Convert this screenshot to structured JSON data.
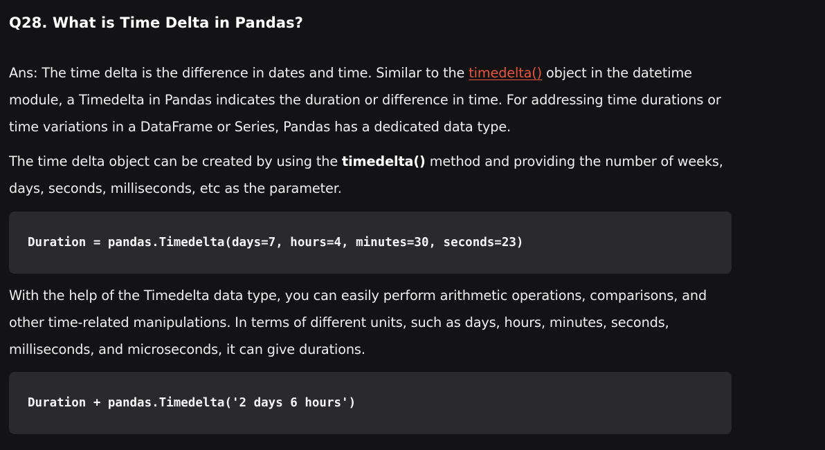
{
  "question": {
    "title": "Q28. What is Time Delta in Pandas?"
  },
  "answer": {
    "p1_before_link": "Ans: The time delta is the difference in dates and time. Similar to the ",
    "p1_link": "timedelta()",
    "p1_after_link": " object in the datetime module, a Timedelta in Pandas indicates the duration or difference in time. For addressing time durations or time variations in a DataFrame or Series, Pandas has a dedicated data type.",
    "p2_before_bold": "The time delta object can be created by using the ",
    "p2_bold": "timedelta()",
    "p2_after_bold": " method and providing the number of weeks, days, seconds, milliseconds, etc as the parameter.",
    "code1": "Duration = pandas.Timedelta(days=7, hours=4, minutes=30, seconds=23)",
    "p3": "With the help of the Timedelta data type, you can easily perform arithmetic operations, comparisons, and other time-related manipulations. In terms of different units, such as days, hours, minutes, seconds, milliseconds, and microseconds, it can give durations.",
    "code2": "Duration + pandas.Timedelta('2 days 6 hours')"
  },
  "colors": {
    "background": "#131315",
    "code_background": "#2a2a2d",
    "link": "#e8553a",
    "text": "#f0f0f0"
  }
}
